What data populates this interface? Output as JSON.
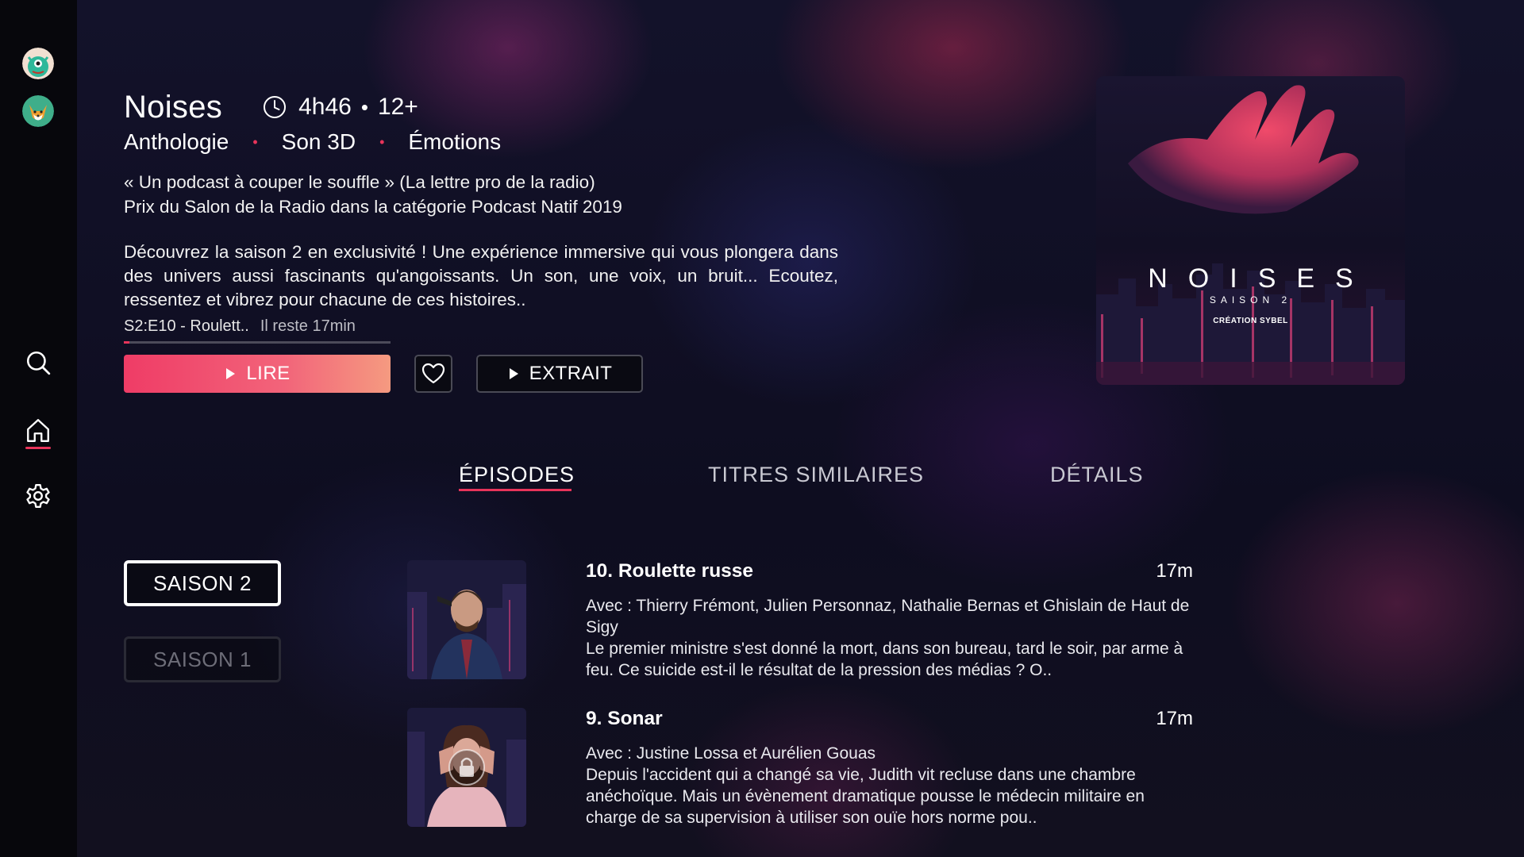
{
  "colors": {
    "accent": "#e8345a",
    "sidebar": "#07070c",
    "background": "#0d0d1c"
  },
  "sidebar": {
    "profiles": [
      {
        "icon": "monster-avatar-icon"
      },
      {
        "icon": "fox-avatar-icon"
      }
    ],
    "nav": [
      {
        "icon": "search-icon"
      },
      {
        "icon": "home-icon",
        "active": true
      },
      {
        "icon": "gear-icon"
      }
    ]
  },
  "header": {
    "title": "Noises",
    "duration": "4h46",
    "age_rating": "12+",
    "dot": "•",
    "tags": [
      "Anthologie",
      "Son 3D",
      "Émotions"
    ],
    "quote_line1": "« Un podcast à couper le souffle » (La lettre pro de la radio)",
    "quote_line2": "Prix du Salon de la Radio dans la catégorie Podcast Natif 2019",
    "description": "Découvrez la saison 2 en exclusivité ! Une expérience immersive qui vous plongera dans des univers aussi fascinants qu'angoissants. Un son, une voix, un bruit... Ecoutez, ressentez et vibrez pour chacune de ces histoires..",
    "resume_episode": "S2:E10 - Roulett..",
    "remaining": "Il reste 17min",
    "progress": 0.02
  },
  "actions": {
    "play_label": "LIRE",
    "trailer_label": "EXTRAIT",
    "favorite_icon": "heart-icon"
  },
  "poster": {
    "title": "NOISES",
    "season": "SAISON 2",
    "credit": "CRÉATION SYBEL"
  },
  "tabs": [
    {
      "label": "ÉPISODES",
      "active": true
    },
    {
      "label": "TITRES SIMILAIRES",
      "active": false
    },
    {
      "label": "DÉTAILS",
      "active": false
    }
  ],
  "seasons": [
    {
      "label": "SAISON 2",
      "selected": true
    },
    {
      "label": "SAISON 1",
      "selected": false
    }
  ],
  "episodes": [
    {
      "title": "10. Roulette russe",
      "duration": "17m",
      "cast": "Avec : Thierry Frémont, Julien Personnaz, Nathalie Bernas et Ghislain de Haut de Sigy",
      "synopsis": "Le premier ministre s'est donné la mort, dans son bureau, tard le soir, par arme à feu. Ce suicide est-il le résultat de la pression des médias ? O..",
      "locked": false
    },
    {
      "title": "9. Sonar",
      "duration": "17m",
      "cast": "Avec : Justine Lossa et Aurélien Gouas",
      "synopsis": "Depuis l'accident qui a changé sa vie, Judith vit recluse dans une chambre anéchoïque. Mais un évènement dramatique pousse le médecin militaire en charge de sa supervision à utiliser son ouïe hors norme pou..",
      "locked": true
    }
  ]
}
